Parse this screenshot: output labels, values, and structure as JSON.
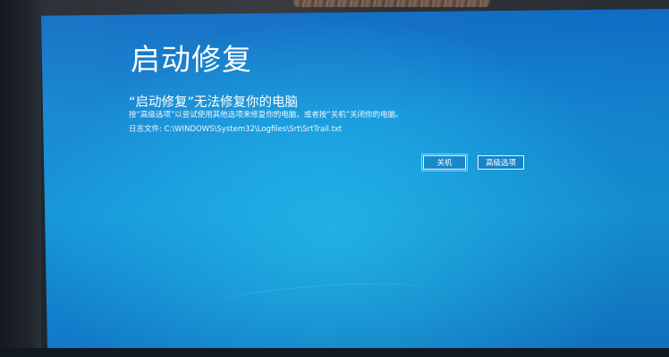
{
  "screen": {
    "title": "启动修复",
    "subtitle": "“启动修复”无法修复你的电脑",
    "description": "按“高级选项”以尝试使用其他选项来修复你的电脑，或者按“关机”关闭你的电脑。",
    "logfile_label": "日志文件: C:\\WINDOWS\\System32\\Logfiles\\Srt\\SrtTrail.txt"
  },
  "buttons": {
    "shutdown_label": "关机",
    "advanced_label": "高级选项"
  },
  "colors": {
    "screen_blue": "#1486d2",
    "text": "#ffffff"
  }
}
